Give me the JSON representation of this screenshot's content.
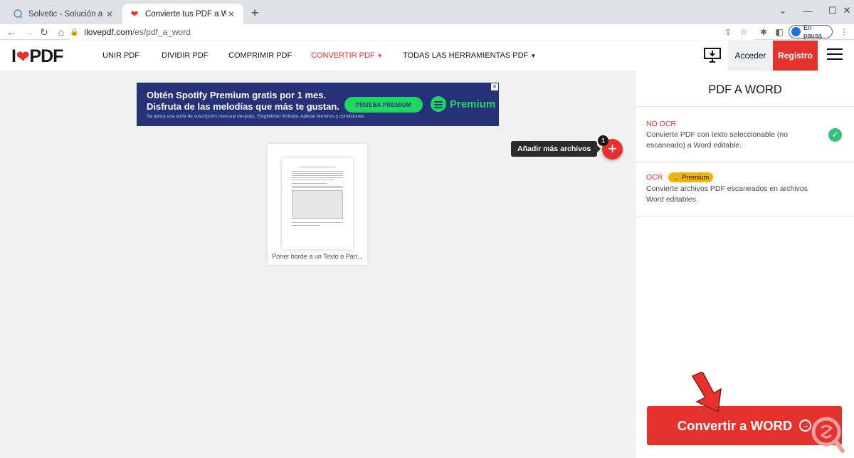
{
  "browser": {
    "tabs": [
      {
        "title": "Solvetic - Solución a los problem",
        "active": false
      },
      {
        "title": "Convierte tus PDF a WORD edita",
        "active": true
      }
    ],
    "url_host": "ilovepdf.com",
    "url_path": "/es/pdf_a_word",
    "profile_label": "En pausa"
  },
  "site": {
    "logo_left": "I",
    "logo_right": "PDF",
    "nav": [
      "UNIR PDF",
      "DIVIDIR PDF",
      "COMPRIMIR PDF",
      "CONVERTIR PDF",
      "TODAS LAS HERRAMIENTAS PDF"
    ],
    "login": "Acceder",
    "register": "Registro"
  },
  "ad": {
    "line1": "Obtén Spotify Premium gratis por 1 mes.",
    "line2": "Disfruta de las melodías que más te gustan.",
    "line3": "Se aplica una tarifa de suscripción mensual después. Elegibilidad limitada. Aplican términos y condiciones.",
    "button": "PRUEBA PREMIUM",
    "brand": "Premium"
  },
  "workspace": {
    "file_name": "Poner borde a un Texto o Parr...",
    "add_tooltip": "Añadir más archivos",
    "file_count": "1"
  },
  "sidebar": {
    "title": "PDF A WORD",
    "options": [
      {
        "title": "NO OCR",
        "desc": "Convierte PDF con texto seleccionable (no escaneado) a Word editable.",
        "selected": true
      },
      {
        "title": "OCR",
        "badge": "Premium",
        "desc": "Convierte archivos PDF escaneados en archivos Word editables.",
        "selected": false
      }
    ],
    "convert_label": "Convertir a WORD"
  },
  "colors": {
    "brand_red": "#e5322d",
    "success_green": "#35c07c",
    "premium_yellow": "#f5b400",
    "ad_blue": "#253279",
    "spotify_green": "#1ed760"
  }
}
